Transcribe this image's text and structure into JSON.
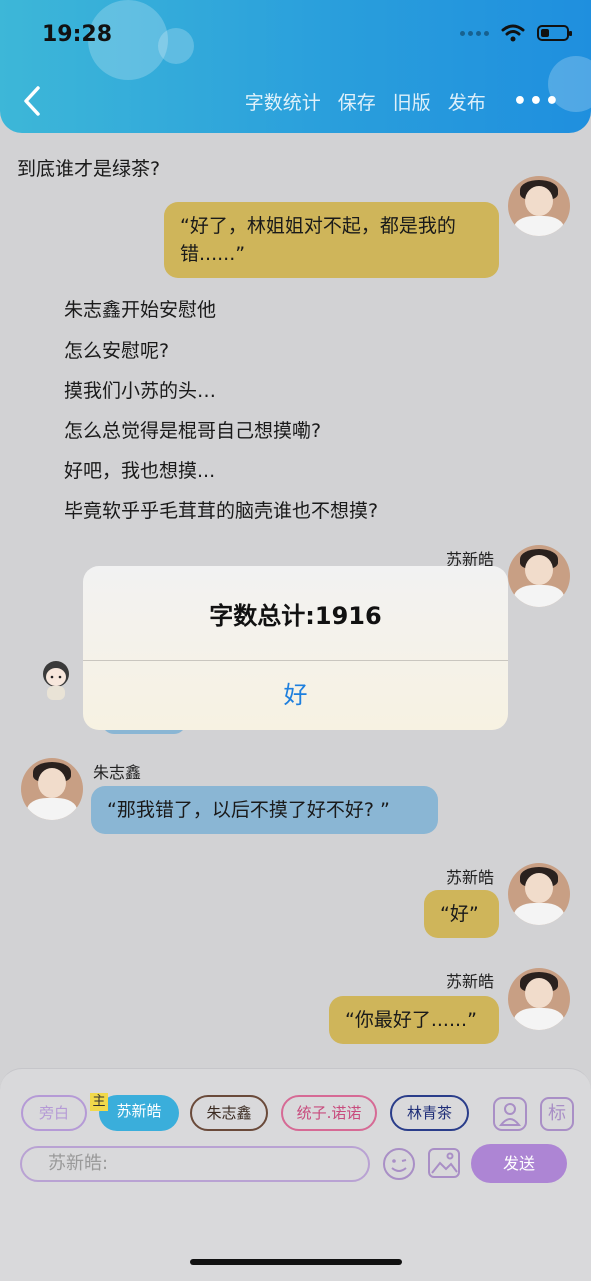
{
  "status": {
    "time": "19:28"
  },
  "toolbar": {
    "word_count": "字数统计",
    "save": "保存",
    "old_version": "旧版",
    "publish": "发布",
    "more": "•••"
  },
  "chat": {
    "title_line": "到底谁才是绿茶?",
    "msg1": "“好了，林姐姐对不起，都是我的错......”",
    "narration": [
      "朱志鑫开始安慰他",
      "怎么安慰呢?",
      "摸我们小苏的头…",
      "怎么总觉得是棍哥自己想摸嘞?",
      "好吧，我也想摸...",
      "毕竟软乎乎毛茸茸的脑壳谁也不想摸?"
    ],
    "name_su": "苏新皓",
    "name_zhu": "朱志鑫",
    "msg_zhu": "“那我错了，以后不摸了好不好? ”",
    "msg_good": "“好”",
    "msg_best": "“你最好了......”"
  },
  "dialog": {
    "title": "字数总计:1916",
    "ok": "好"
  },
  "roles": {
    "main_tag": "主",
    "chips": [
      "旁白",
      "苏新皓",
      "朱志鑫",
      "统子.诺诺",
      "林青茶"
    ],
    "tag_icon": "标"
  },
  "composer": {
    "placeholder": "苏新皓:",
    "send": "发送"
  },
  "colors": {
    "header_start": "#3db7d8",
    "header_end": "#1f8fde",
    "gold_bubble": "#cfb55a",
    "blue_bubble": "#8ab6d4",
    "accent_purple": "#ad85d4",
    "dialog_button": "#1d7fde"
  },
  "icons": {
    "back": "chevron-left-icon",
    "wifi": "wifi-icon",
    "battery": "battery-icon",
    "person": "person-icon",
    "emoji": "smiley-icon",
    "image": "image-icon"
  }
}
